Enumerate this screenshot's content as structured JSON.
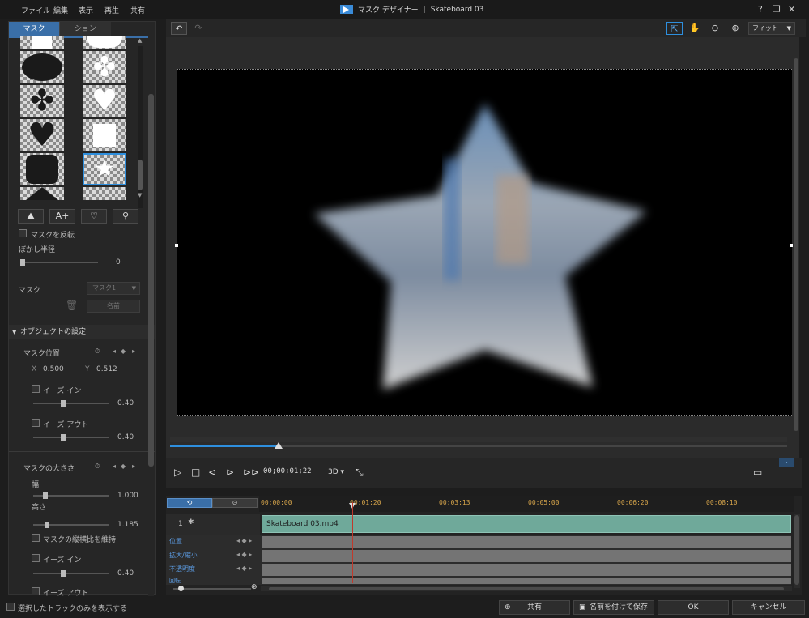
{
  "menu": [
    "ファイル",
    "編集",
    "表示",
    "再生",
    "共有"
  ],
  "app_title": "マスク デザイナー",
  "project_title": "Skateboard 03",
  "window_controls": [
    "?",
    "❐",
    "✕"
  ],
  "left_panel": {
    "tabs": [
      "マスク",
      "ション"
    ],
    "tool_buttons": [
      "⛰",
      "A+",
      "♡",
      "⚲"
    ],
    "invert_label": "マスクを反転",
    "feather_label": "ぼかし半径",
    "feather_value": "0",
    "mask_label": "マスク",
    "mask_dropdown": "マスク1",
    "delete_icon": "trash-icon",
    "rename_button": "名前",
    "object_settings": "オブジェクトの設定",
    "mask_position": {
      "label": "マスク位置",
      "x_label": "X",
      "x_value": "0.500",
      "y_label": "Y",
      "y_value": "0.512",
      "ease_in": "イーズ イン",
      "ease_in_value": "0.40",
      "ease_out": "イーズ アウト",
      "ease_out_value": "0.40"
    },
    "mask_size": {
      "label": "マスクの大きさ",
      "width_label": "幅",
      "width_value": "1.000",
      "height_label": "高さ",
      "height_value": "1.185",
      "keep_ratio": "マスクの縦横比を維持",
      "ease_in": "イーズ イン",
      "ease_in_value": "0.40",
      "ease_out": "イーズ アウト"
    }
  },
  "show_selected_only": "選択したトラックのみを表示する",
  "toolbar": {
    "undo": "↶",
    "redo": "↷",
    "fit_label": "フィット"
  },
  "player": {
    "timecode": "00;00;01;22",
    "mode_3d": "3D"
  },
  "timeline": {
    "ruler_ticks": [
      "00;00;00",
      "00;01;20",
      "00;03;13",
      "00;05;00",
      "00;06;20",
      "00;08;10"
    ],
    "track_number": "1",
    "clip_name": "Skateboard 03.mp4",
    "sub_tracks": [
      "位置",
      "拡大/縮小",
      "不透明度",
      "回転"
    ]
  },
  "buttons": {
    "share": "共有",
    "save_as": "名前を付けて保存",
    "ok": "OK",
    "cancel": "キャンセル"
  },
  "colors": {
    "accent": "#2e8fde",
    "clip": "#6fa99a",
    "ruler_text": "#d4a34a",
    "playhead": "#c0392b"
  }
}
